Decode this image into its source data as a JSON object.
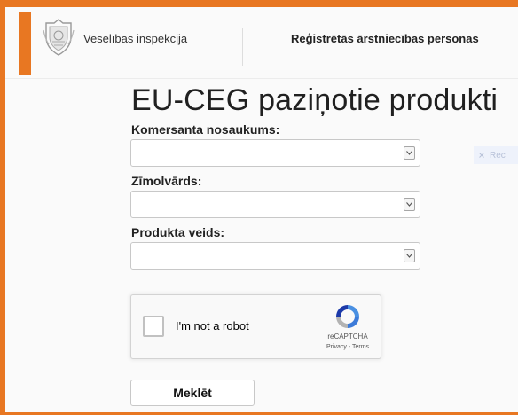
{
  "header": {
    "org_name": "Veselības inspekcija",
    "nav_link": "Reģistrētās ārstniecības personas"
  },
  "page": {
    "title": "EU-CEG paziņotie produkti"
  },
  "form": {
    "fields": [
      {
        "label": "Komersanta nosaukums:",
        "value": ""
      },
      {
        "label": "Zīmolvārds:",
        "value": ""
      },
      {
        "label": "Produkta veids:",
        "value": ""
      }
    ],
    "side_button": "Rec",
    "search_label": "Meklēt"
  },
  "recaptcha": {
    "label": "I'm not a robot",
    "brand": "reCAPTCHA",
    "privacy": "Privacy",
    "separator": " - ",
    "terms": "Terms"
  },
  "colors": {
    "accent": "#e87722",
    "recaptcha_blue": "#4a90e2"
  }
}
